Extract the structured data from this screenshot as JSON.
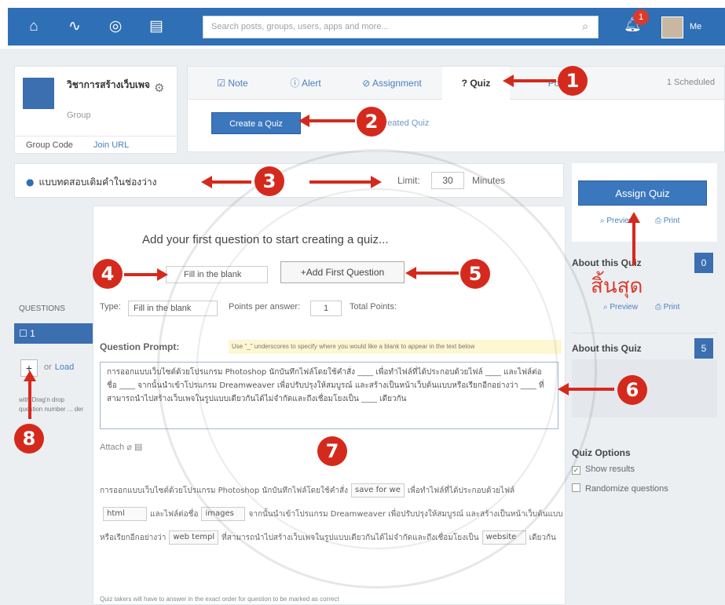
{
  "topnav": {
    "search_placeholder": "Search posts, groups, users, apps and more...",
    "notifications_count": "1",
    "user_label": "Me",
    "icons": [
      "home-icon",
      "activity-icon",
      "compass-icon",
      "book-icon",
      "search-icon",
      "bell-icon"
    ]
  },
  "group": {
    "name": "วิชาการสร้างเว็บเพจ",
    "type": "Group",
    "links": [
      "Group Code",
      "Join URL"
    ]
  },
  "post_tabs": {
    "tabs": [
      "Note",
      "Alert",
      "Assignment",
      "Quiz",
      "Po"
    ],
    "active": "Quiz",
    "scheduled": "1 Scheduled",
    "create_button": "Create a Quiz",
    "previous_link": "ly created Quiz"
  },
  "quiz": {
    "title": "แบบทดสอบเติมคำในช่องว่าง",
    "time_limit_label": "Limit:",
    "time_limit_value": "30",
    "minutes_label": "Minutes",
    "add_first_heading": "Add your first question to start creating a quiz...",
    "type_select_value": "Fill in the blank",
    "add_first_button": "+Add First Question"
  },
  "questions": {
    "label": "QUESTIONS",
    "item": "1",
    "add": "+",
    "or": "or",
    "load": "Load",
    "drag_note": "with Drag'n drop question number ... der"
  },
  "editor": {
    "type_label": "Type:",
    "type_value": "Fill in the blank",
    "points_label": "Points per answer:",
    "points_value": "1",
    "total_label": "Total Points:",
    "prompt_label": "Question Prompt:",
    "hint": "Use \"_\" underscores to specify where you would like a blank to appear in the text below",
    "prompt_text": "การออกแบบเว็บไซต์ด้วยโปรแกรม Photoshop นักบันทึกไฟล์โดยใช้คำสั่ง ____ เพื่อทำไฟล์ที่ได้ประกอบด้วยไฟล์ ____ และไฟล์ต่อชื่อ ____ จากนั้นนำเข้าโปรแกรม Dreamweaver เพื่อปรับปรุงให้สมบูรณ์ และสร้างเป็นหน้าเว็บต้นแบบหรือเรียกอีกอย่างว่า ____ ที่สามารถนำไปสร้างเว็บเพจในรูปแบบเดียวกันได้ไม่จำกัดและถึงเชื่อมโยงเป็น ____ เดียวกัน",
    "attach_label": "Attach",
    "preview": {
      "p1": "การออกแบบเว็บไซต์ด้วยโปรแกรม Photoshop นักบันทึกไฟล์โดยใช้คำสั่ง",
      "b1": "save for we",
      "p2": "เพื่อทำไฟล์ที่ได้ประกอบด้วยไฟล์",
      "b2": "html",
      "p3": "และไฟล์ต่อชื่อ",
      "b3": "images",
      "p4": "จากนั้นนำเข้าโปรแกรม Dreamweaver เพื่อปรับปรุงให้สมบูรณ์ และสร้างเป็นหน้าเว็บต้นแบบหรือเรียกอีกอย่างว่า",
      "b4": "web templ",
      "p5": "ที่สามารถนำไปสร้างเว็บเพจในรูปแบบเดียวกันได้ไม่จำกัดและถึงเชื่อมโยงเป็น",
      "b5": "website",
      "p6": "เดียวกัน"
    },
    "footnote": "Quiz takers will have to answer in the exact order for question to be marked as correct"
  },
  "sidebar": {
    "assign_button": "Assign Quiz",
    "preview": "Preview",
    "print": "Print",
    "about_title": "About this Quiz",
    "about_count": "0",
    "finish_label": "สิ้นสุด",
    "about_title_2": "About this Quiz",
    "about_count_2": "5",
    "options_title": "Quiz Options",
    "option_show_results": "Show results",
    "option_randomize": "Randomize questions"
  },
  "annotations": [
    "1",
    "2",
    "3",
    "4",
    "5",
    "6",
    "7",
    "8"
  ]
}
